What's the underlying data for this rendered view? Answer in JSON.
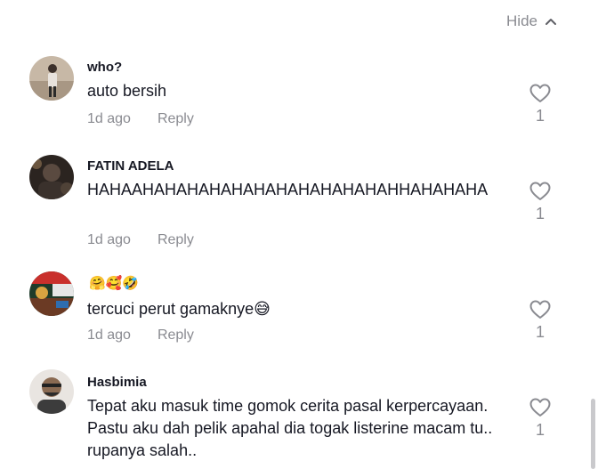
{
  "header": {
    "hide_label": "Hide"
  },
  "comments": [
    {
      "username": "who?",
      "text": "auto bersih",
      "time": "1d ago",
      "reply_label": "Reply",
      "likes": "1"
    },
    {
      "username": "FATIN ADELA",
      "text": "HAHAAHAHAHAHAHAHAHAHAHAHAHAHHAHAHAHA",
      "time": "1d ago",
      "reply_label": "Reply",
      "likes": "1"
    },
    {
      "username": "🤗🥰🤣",
      "text": "tercuci perut gamaknye😅",
      "time": "1d ago",
      "reply_label": "Reply",
      "likes": "1"
    },
    {
      "username": "Hasbimia",
      "text": "Tepat aku masuk time gomok cerita pasal kerpercayaan. Pastu aku dah pelik apahal dia togak listerine macam tu.. rupanya salah..",
      "likes": "1"
    }
  ],
  "colors": {
    "text_primary": "#161823",
    "text_secondary": "#8a8b91",
    "background": "#ffffff"
  },
  "icons": {
    "hide": "chevron-up-icon",
    "like": "heart-outline-icon"
  }
}
